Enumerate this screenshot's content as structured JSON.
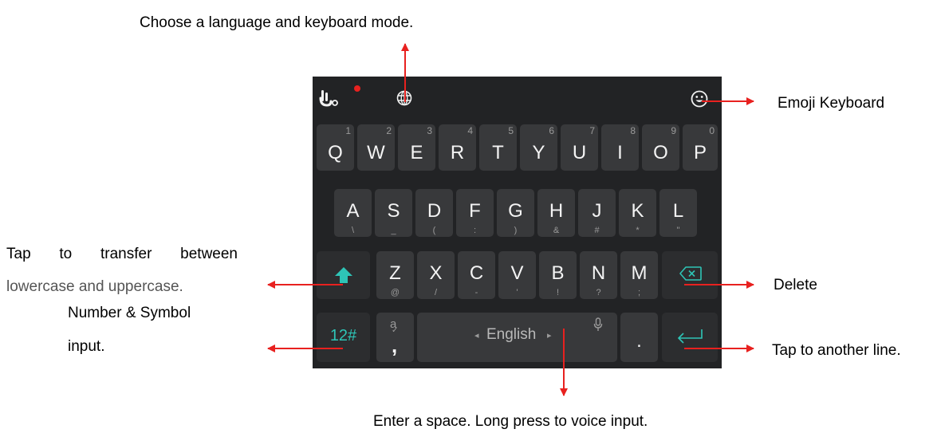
{
  "annotations": {
    "language": "Choose a language and keyboard mode.",
    "emoji": "Emoji Keyboard",
    "shift_line1": "Tap to transfer between",
    "shift_line2": "lowercase and uppercase.",
    "delete": "Delete",
    "number_line1": "Number & Symbol",
    "number_line2": "input.",
    "enter": "Tap to another line.",
    "space": "Enter a space. Long press to voice input."
  },
  "keyboard": {
    "row1": [
      {
        "main": "Q",
        "sup": "1"
      },
      {
        "main": "W",
        "sup": "2"
      },
      {
        "main": "E",
        "sup": "3"
      },
      {
        "main": "R",
        "sup": "4"
      },
      {
        "main": "T",
        "sup": "5"
      },
      {
        "main": "Y",
        "sup": "6"
      },
      {
        "main": "U",
        "sup": "7"
      },
      {
        "main": "I",
        "sup": "8"
      },
      {
        "main": "O",
        "sup": "9"
      },
      {
        "main": "P",
        "sup": "0"
      }
    ],
    "row2": [
      {
        "main": "A",
        "sub": "\\"
      },
      {
        "main": "S",
        "sub": "_"
      },
      {
        "main": "D",
        "sub": "("
      },
      {
        "main": "F",
        "sub": ":"
      },
      {
        "main": "G",
        "sub": ")"
      },
      {
        "main": "H",
        "sub": "&"
      },
      {
        "main": "J",
        "sub": "#"
      },
      {
        "main": "K",
        "sub": "*"
      },
      {
        "main": "L",
        "sub": "\""
      }
    ],
    "row3": [
      {
        "main": "Z",
        "sub": "@"
      },
      {
        "main": "X",
        "sub": "/"
      },
      {
        "main": "C",
        "sub": "-"
      },
      {
        "main": "V",
        "sub": "'"
      },
      {
        "main": "B",
        "sub": "!"
      },
      {
        "main": "N",
        "sub": "?"
      },
      {
        "main": "M",
        "sub": ";"
      }
    ],
    "numbers_key": "12#",
    "comma_key": {
      "main": ",",
      "sup": "a"
    },
    "space_label": "English",
    "period_key": ".",
    "colors": {
      "background": "#222325",
      "key": "#38393b",
      "accent": "#2ec4b6",
      "arrow": "#e8211f"
    }
  }
}
